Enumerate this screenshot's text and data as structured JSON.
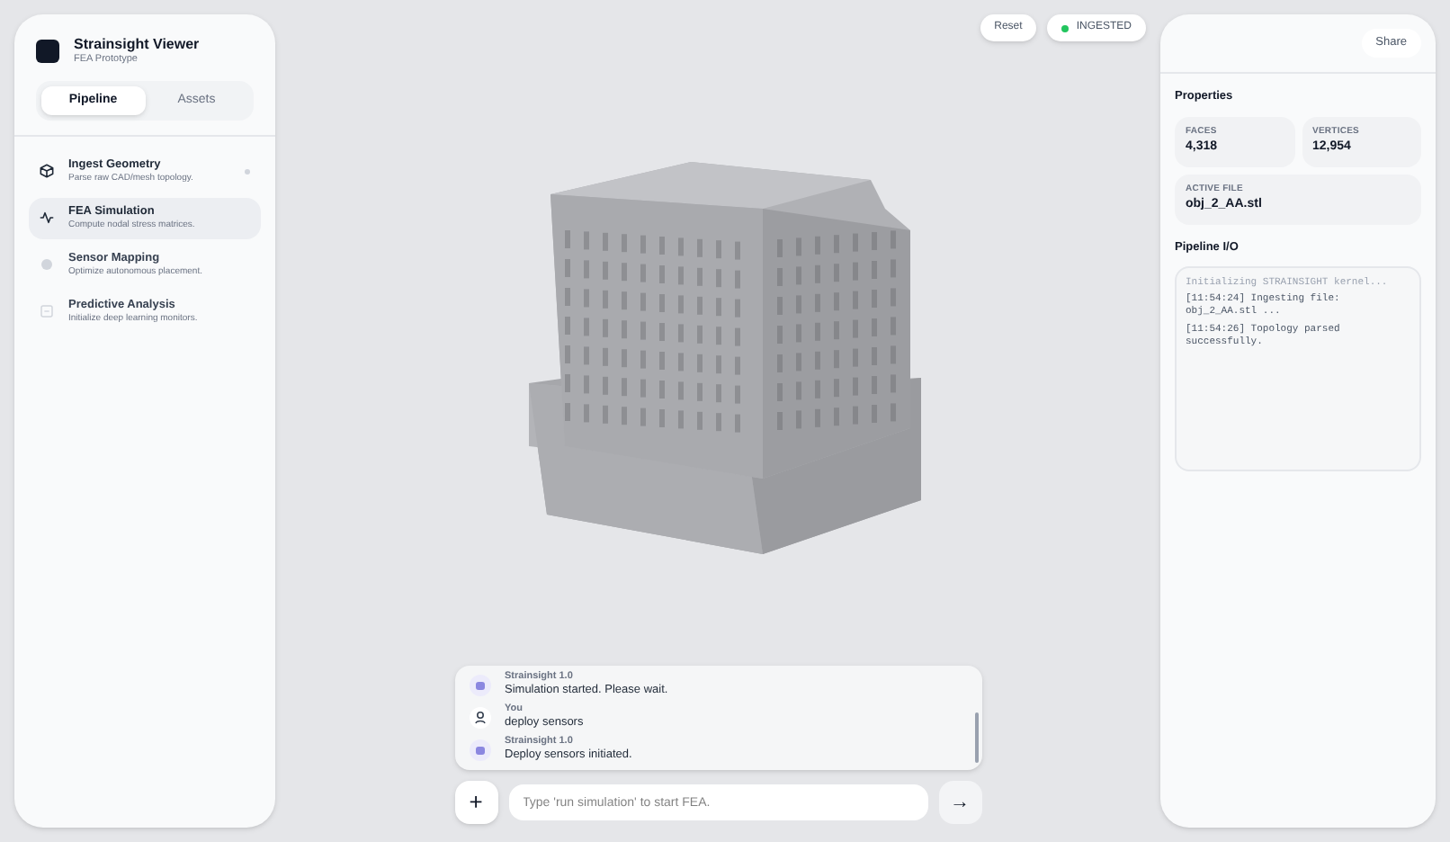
{
  "app": {
    "title": "Strainsight Viewer",
    "subtitle": "FEA Prototype"
  },
  "tabs": [
    {
      "label": "Pipeline",
      "selected": true
    },
    {
      "label": "Assets",
      "selected": false
    }
  ],
  "pipeline": [
    {
      "kind": "cube",
      "title": "Ingest Geometry",
      "description": "Parse raw CAD/mesh topology.",
      "selected": false,
      "complete": true,
      "enabled": true
    },
    {
      "kind": "activity",
      "title": "FEA Simulation",
      "description": "Compute nodal stress matrices.",
      "selected": true,
      "complete": false,
      "enabled": true
    },
    {
      "kind": "circle",
      "title": "Sensor Mapping",
      "description": "Optimize autonomous placement.",
      "selected": false,
      "complete": false,
      "enabled": false
    },
    {
      "kind": "square",
      "title": "Predictive Analysis",
      "description": "Initialize deep learning monitors.",
      "selected": false,
      "complete": false,
      "enabled": false
    }
  ],
  "toolbar": {
    "reset": "Reset",
    "status": "INGESTED"
  },
  "chat": {
    "messages": [
      {
        "kind": "bot",
        "sender": "Strainsight 1.0",
        "text": "Simulation started. Please wait."
      },
      {
        "kind": "user",
        "sender": "You",
        "text": "deploy sensors"
      },
      {
        "kind": "bot",
        "sender": "Strainsight 1.0",
        "text": "Deploy sensors initiated."
      }
    ],
    "input": {
      "placeholder": "Type 'run simulation' to start FEA."
    },
    "add": "+",
    "send": "→"
  },
  "right_panel": {
    "share": "Share",
    "properties_title": "Properties",
    "properties": [
      {
        "label": "FACES",
        "value": "4,318"
      },
      {
        "label": "VERTICES",
        "value": "12,954"
      },
      {
        "label": "ACTIVE FILE",
        "value": "obj_2_AA.stl"
      }
    ],
    "io_title": "Pipeline I/O",
    "log": [
      {
        "kind": "muted",
        "text": "Initializing STRAINSIGHT kernel..."
      },
      {
        "kind": "normal",
        "text": "[11:54:24] Ingesting file: obj_2_AA.stl ..."
      },
      {
        "kind": "normal",
        "text": "[11:54:26] Topology parsed successfully."
      }
    ]
  }
}
